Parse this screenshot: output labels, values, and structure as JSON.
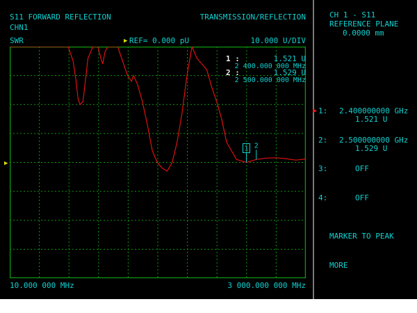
{
  "header": {
    "measurement_title": "S11 FORWARD REFLECTION",
    "channel": "CHN1",
    "mode": "TRANSMISSION/REFLECTION",
    "format": "SWR",
    "reference": "REF= 0.000 pU",
    "scale": "10.000 U/DIV"
  },
  "readout": {
    "m1_label": "1 :",
    "m1_value": "1.521 U",
    "m1_freq": "2 400.000 000 MHz",
    "m2_label": "2 :",
    "m2_value": "1.529 U",
    "m2_freq": "2 500.000 000 MHz"
  },
  "footer": {
    "start_freq": "10.000 000 MHz",
    "stop_freq": "3 000.000 000 MHz"
  },
  "sidebar": {
    "title_line1": "CH 1 - S11",
    "title_line2": "REFERENCE PLANE",
    "title_line3": "0.0000 mm",
    "markers": [
      {
        "num": "1:",
        "freq": "2.400000000 GHz",
        "value": "1.521 U"
      },
      {
        "num": "2:",
        "freq": "2.500000000 GHz",
        "value": "1.529 U"
      },
      {
        "num": "3:",
        "state": "OFF"
      },
      {
        "num": "4:",
        "state": "OFF"
      }
    ],
    "marker_to_peak": "MARKER TO PEAK",
    "more": "MORE"
  },
  "plot_markers": {
    "m1": "1",
    "m2": "2"
  },
  "colors": {
    "background": "#000000",
    "text": "#12d0d0",
    "grid": "#0f9a0f",
    "trace": "#dd1111",
    "active_marker_arrow": "#ff1a1a",
    "reference_arrow": "#e0e000"
  },
  "chart_data": {
    "type": "line",
    "x_start": 10,
    "x_stop": 3000,
    "x_unit": "MHz",
    "ylim": [
      0,
      80
    ],
    "y_divisions": 8,
    "x_divisions": 10,
    "grid": true,
    "series": [
      {
        "x": [
          10,
          150,
          300,
          500,
          600,
          650,
          680,
          700,
          720,
          750,
          780,
          800,
          850,
          900,
          930,
          950,
          970,
          1000,
          1050,
          1100,
          1150,
          1200,
          1240,
          1260,
          1300,
          1350,
          1400,
          1450,
          1500,
          1550,
          1600,
          1650,
          1700,
          1750,
          1800,
          1850,
          1900,
          1950,
          2000,
          2050,
          2100,
          2150,
          2200,
          2300,
          2400,
          2500,
          2600,
          2700,
          2800,
          2900,
          3000
        ],
        "y": [
          80,
          80,
          80,
          80,
          80,
          75,
          68,
          62,
          60,
          61,
          70,
          76,
          80,
          80,
          76,
          74,
          78,
          80,
          80,
          80,
          75,
          70,
          68,
          70,
          67,
          61,
          53,
          44,
          40,
          38,
          37,
          40,
          47,
          57,
          70,
          80,
          76,
          74,
          72,
          66,
          61,
          55,
          47,
          41,
          40,
          41,
          41.5,
          41.6,
          41.3,
          40.8,
          41.2
        ]
      }
    ],
    "markers": [
      {
        "name": "1",
        "x": 2400
      },
      {
        "name": "2",
        "x": 2500
      }
    ]
  }
}
